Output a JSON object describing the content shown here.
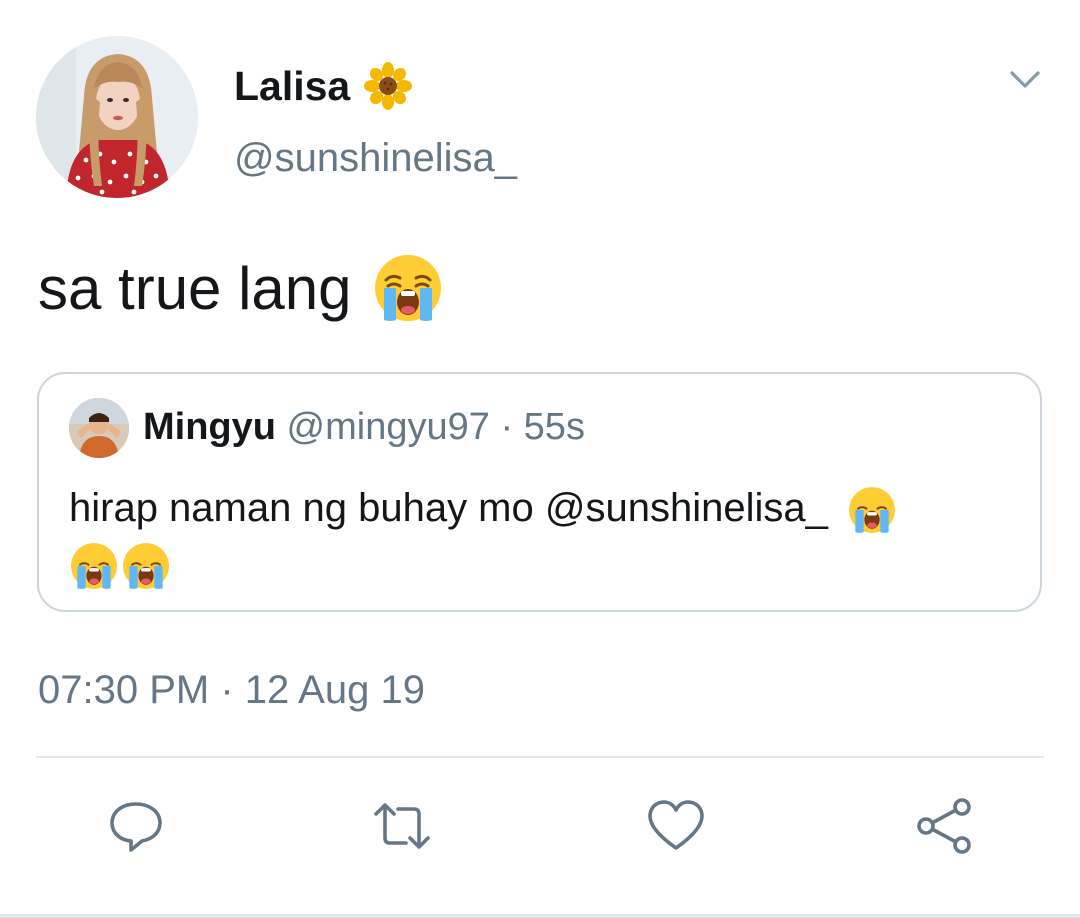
{
  "author": {
    "display_name": "Lalisa",
    "handle": "@sunshinelisa_",
    "name_emoji": "sunflower-icon"
  },
  "tweet": {
    "text": "sa true lang",
    "emoji": "loudly-crying-face-icon",
    "timestamp": "07:30 PM · 12 Aug 19"
  },
  "quoted_tweet": {
    "display_name": "Mingyu",
    "handle": "@mingyu97",
    "separator": "·",
    "time": "55s",
    "text": "hirap naman ng buhay mo @sunshinelisa_",
    "emoji_count": 3
  },
  "actions": [
    {
      "name": "reply",
      "icon": "reply-icon"
    },
    {
      "name": "retweet",
      "icon": "retweet-icon"
    },
    {
      "name": "like",
      "icon": "heart-icon"
    },
    {
      "name": "share",
      "icon": "share-icon"
    }
  ],
  "colors": {
    "primary_text": "#14171a",
    "secondary_text": "#657786",
    "border": "#ccd6dd",
    "icon": "#657786"
  }
}
